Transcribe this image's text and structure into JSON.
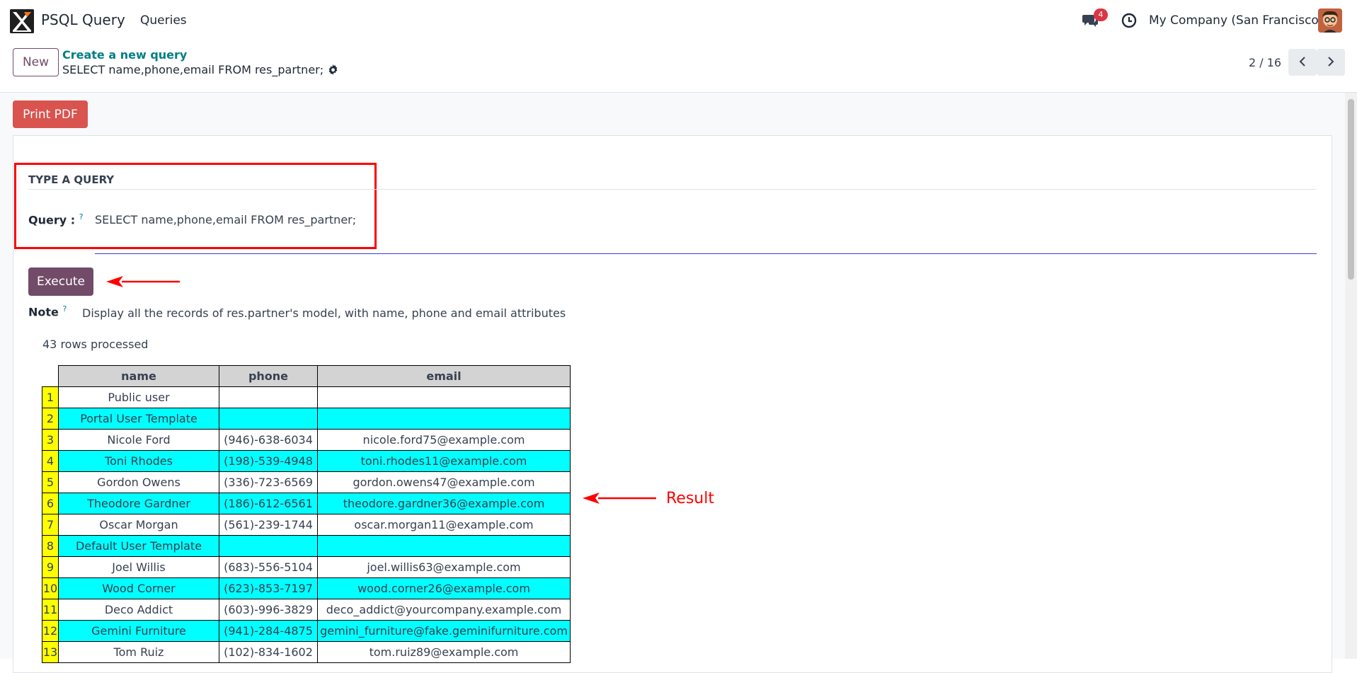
{
  "navbar": {
    "app_title": "PSQL Query",
    "menu_item": "Queries",
    "chat_badge": "4",
    "company": "My Company (San Francisco)"
  },
  "control_panel": {
    "new_label": "New",
    "breadcrumb_parent": "Create a new query",
    "breadcrumb_current": "SELECT name,phone,email FROM res_partner;",
    "pager": "2 / 16"
  },
  "actions": {
    "print_label": "Print PDF",
    "execute_label": "Execute"
  },
  "form": {
    "section_title": "TYPE A QUERY",
    "query_label": "Query :",
    "query_value": "SELECT name,phone,email FROM res_partner;",
    "note_label": "Note",
    "note_value": "Display all the records of res.partner's model, with name, phone and email attributes",
    "help_mark": "?"
  },
  "result": {
    "rows_processed": "43 rows processed",
    "annotation": "Result",
    "columns": [
      "name",
      "phone",
      "email"
    ],
    "rows": [
      {
        "n": "1",
        "name": "Public user",
        "phone": "",
        "email": ""
      },
      {
        "n": "2",
        "name": "Portal User Template",
        "phone": "",
        "email": ""
      },
      {
        "n": "3",
        "name": "Nicole Ford",
        "phone": "(946)-638-6034",
        "email": "nicole.ford75@example.com"
      },
      {
        "n": "4",
        "name": "Toni Rhodes",
        "phone": "(198)-539-4948",
        "email": "toni.rhodes11@example.com"
      },
      {
        "n": "5",
        "name": "Gordon Owens",
        "phone": "(336)-723-6569",
        "email": "gordon.owens47@example.com"
      },
      {
        "n": "6",
        "name": "Theodore Gardner",
        "phone": "(186)-612-6561",
        "email": "theodore.gardner36@example.com"
      },
      {
        "n": "7",
        "name": "Oscar Morgan",
        "phone": "(561)-239-1744",
        "email": "oscar.morgan11@example.com"
      },
      {
        "n": "8",
        "name": "Default User Template",
        "phone": "",
        "email": ""
      },
      {
        "n": "9",
        "name": "Joel Willis",
        "phone": "(683)-556-5104",
        "email": "joel.willis63@example.com"
      },
      {
        "n": "10",
        "name": "Wood Corner",
        "phone": "(623)-853-7197",
        "email": "wood.corner26@example.com"
      },
      {
        "n": "11",
        "name": "Deco Addict",
        "phone": "(603)-996-3829",
        "email": "deco_addict@yourcompany.example.com"
      },
      {
        "n": "12",
        "name": "Gemini Furniture",
        "phone": "(941)-284-4875",
        "email": "gemini_furniture@fake.geminifurniture.com"
      },
      {
        "n": "13",
        "name": "Tom Ruiz",
        "phone": "(102)-834-1602",
        "email": "tom.ruiz89@example.com"
      }
    ]
  },
  "colors": {
    "brand": "#714b67",
    "link": "#017e84",
    "print_button": "#d9534f",
    "highlight_frame": "#ff0000",
    "index_cell": "#ffff00",
    "alt_row": "#00ffff"
  }
}
